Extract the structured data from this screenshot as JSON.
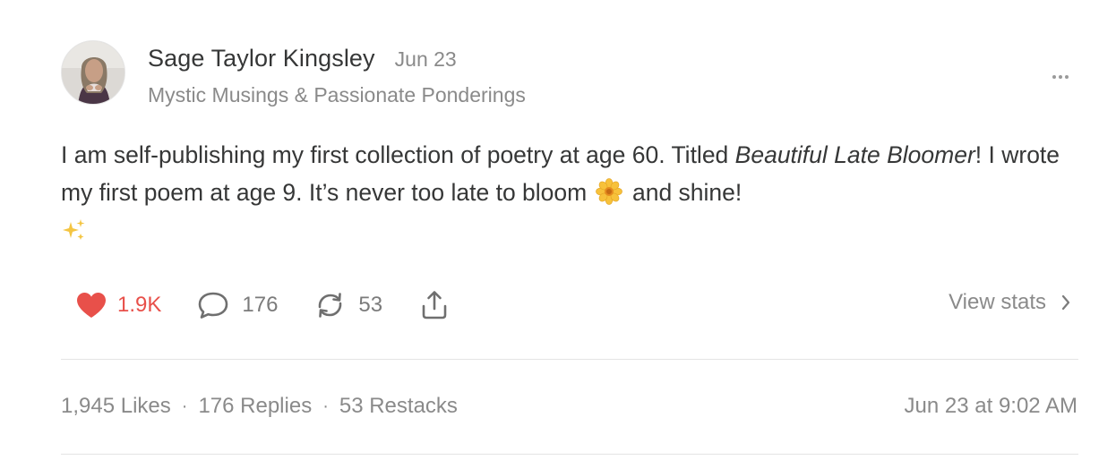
{
  "post": {
    "author": "Sage Taylor Kingsley",
    "date": "Jun 23",
    "publication": "Mystic Musings & Passionate Ponderings",
    "body": {
      "part1": "I am self-publishing my first collection of poetry at age 60. Titled ",
      "title_italic": "Beautiful Late Bloomer",
      "part2": "! I wrote my first poem at age 9. It’s never too late to bloom",
      "part3": "and shine!"
    }
  },
  "actions": {
    "likes": "1.9K",
    "replies": "176",
    "restacks": "53",
    "view_stats_label": "View stats"
  },
  "footer": {
    "likes": "1,945 Likes",
    "replies": "176 Replies",
    "restacks": "53 Restacks",
    "separator": "·",
    "timestamp": "Jun 23 at 9:02 AM"
  },
  "colors": {
    "like": "#e8504a",
    "text": "#363737",
    "muted": "#8a8a8a"
  },
  "icons": {
    "more": "more-horizontal-icon",
    "like": "heart-icon",
    "reply": "comment-bubble-icon",
    "restack": "restack-icon",
    "share": "share-icon",
    "stats": "chevron-right-icon"
  }
}
